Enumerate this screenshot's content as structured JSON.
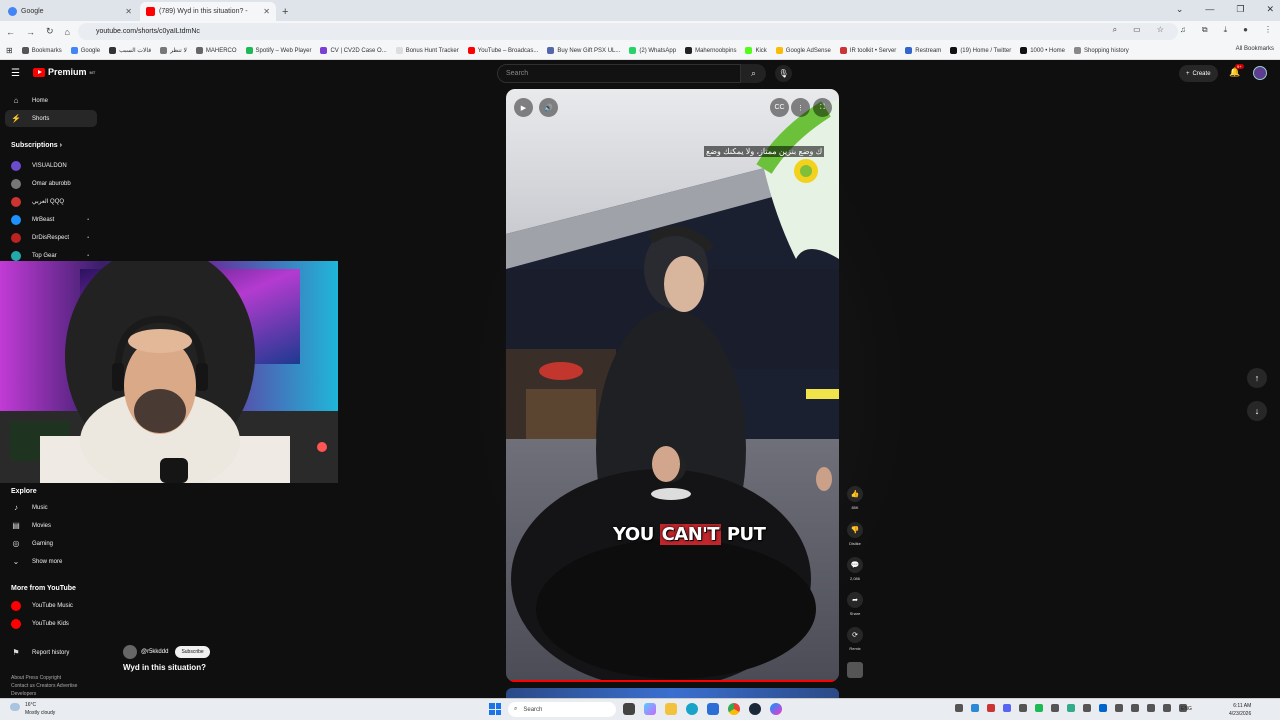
{
  "browser": {
    "tabs": [
      {
        "title": "Google",
        "favicon_color": "#4285f4",
        "active": false
      },
      {
        "title": "(789) Wyd in this situation? - ",
        "favicon_color": "#ff0000",
        "active": true
      }
    ],
    "new_tab_symbol": "+",
    "url": "youtube.com/shorts/c0yaILtdmNc",
    "bookmarks": [
      {
        "label": "Bookmarks",
        "color": "#555"
      },
      {
        "label": "Google",
        "color": "#4285f4"
      },
      {
        "label": "قالات السبب",
        "color": "#333"
      },
      {
        "label": "لا تنظر",
        "color": "#777"
      },
      {
        "label": "MAHERCO",
        "color": "#666"
      },
      {
        "label": "Spotify – Web Player",
        "color": "#1db954"
      },
      {
        "label": "CV | CV2D Case O...",
        "color": "#7b3fd1"
      },
      {
        "label": "Bonus Hunt Tracker",
        "color": "#ddd"
      },
      {
        "label": "YouTube – Broadcas...",
        "color": "#ff0000"
      },
      {
        "label": "Buy New Gift PSX UL...",
        "color": "#5566aa"
      },
      {
        "label": "(2) WhatsApp",
        "color": "#25d366"
      },
      {
        "label": "Mahernoobpins",
        "color": "#222"
      },
      {
        "label": "Kick",
        "color": "#53fc18"
      },
      {
        "label": "Google AdSense",
        "color": "#fbbc04"
      },
      {
        "label": "IR toolkit • Server",
        "color": "#cc3333"
      },
      {
        "label": "Restream",
        "color": "#3366cc"
      },
      {
        "label": "(19) Home / Twitter",
        "color": "#111"
      },
      {
        "label": "1000 • Home",
        "color": "#111"
      },
      {
        "label": "Shopping history",
        "color": "#888"
      }
    ],
    "all_bookmarks": "All Bookmarks"
  },
  "youtube": {
    "logo_text": "Premium",
    "logo_sup": "MT",
    "search_placeholder": "Search",
    "create_label": "Create",
    "notif_count": "9+",
    "sidebar": {
      "main": [
        {
          "label": "Home",
          "icon": "home-icon",
          "glyph": "⌂"
        },
        {
          "label": "Shorts",
          "icon": "shorts-icon",
          "glyph": "⚡",
          "selected": true
        }
      ],
      "subscriptions_header": "Subscriptions",
      "subscriptions": [
        {
          "label": "VISUALDON",
          "color": "#6a4ccf"
        },
        {
          "label": "Omar aburobb",
          "color": "#777"
        },
        {
          "label": "العربي QQQ",
          "color": "#c33"
        },
        {
          "label": "MrBeast",
          "color": "#1e90ff",
          "live": "•"
        },
        {
          "label": "DrDisRespect",
          "color": "#b22",
          "live": "•"
        },
        {
          "label": "Top Gear",
          "color": "#2aa",
          "live": "•"
        }
      ],
      "explore_header": "Explore",
      "explore": [
        {
          "label": "Music",
          "glyph": "♪",
          "icon": "music-icon"
        },
        {
          "label": "Movies",
          "glyph": "▤",
          "icon": "movies-icon"
        },
        {
          "label": "Gaming",
          "glyph": "◎",
          "icon": "gaming-icon"
        },
        {
          "label": "Show more",
          "glyph": "⌄",
          "icon": "chevron-down-icon"
        }
      ],
      "more_header": "More from YouTube",
      "more": [
        {
          "label": "YouTube Music",
          "color": "#f00"
        },
        {
          "label": "YouTube Kids",
          "color": "#f00"
        }
      ],
      "report": "Report history",
      "footer1": "About  Press  Copyright",
      "footer2": "Contact us  Creators  Advertise",
      "footer3": "Developers"
    },
    "short": {
      "arabic_subtitle": "ك وضع بنزين ممتاز، ولا يمكنك وضع",
      "caption_before": "YOU ",
      "caption_highlight": "CAN'T",
      "caption_after": " PUT",
      "channel": "@r5kkddd",
      "subscribe": "Subscribe",
      "title": "Wyd in this situation?",
      "likes": "85K",
      "dislike": "Dislike",
      "comments": "2,086",
      "share": "Share",
      "remix": "Remix"
    }
  },
  "taskbar": {
    "temp": "16°C",
    "weather": "Mostly cloudy",
    "search": "Search",
    "lang": "ENG",
    "time": "6:11 AM",
    "date": "4/23/2026"
  }
}
